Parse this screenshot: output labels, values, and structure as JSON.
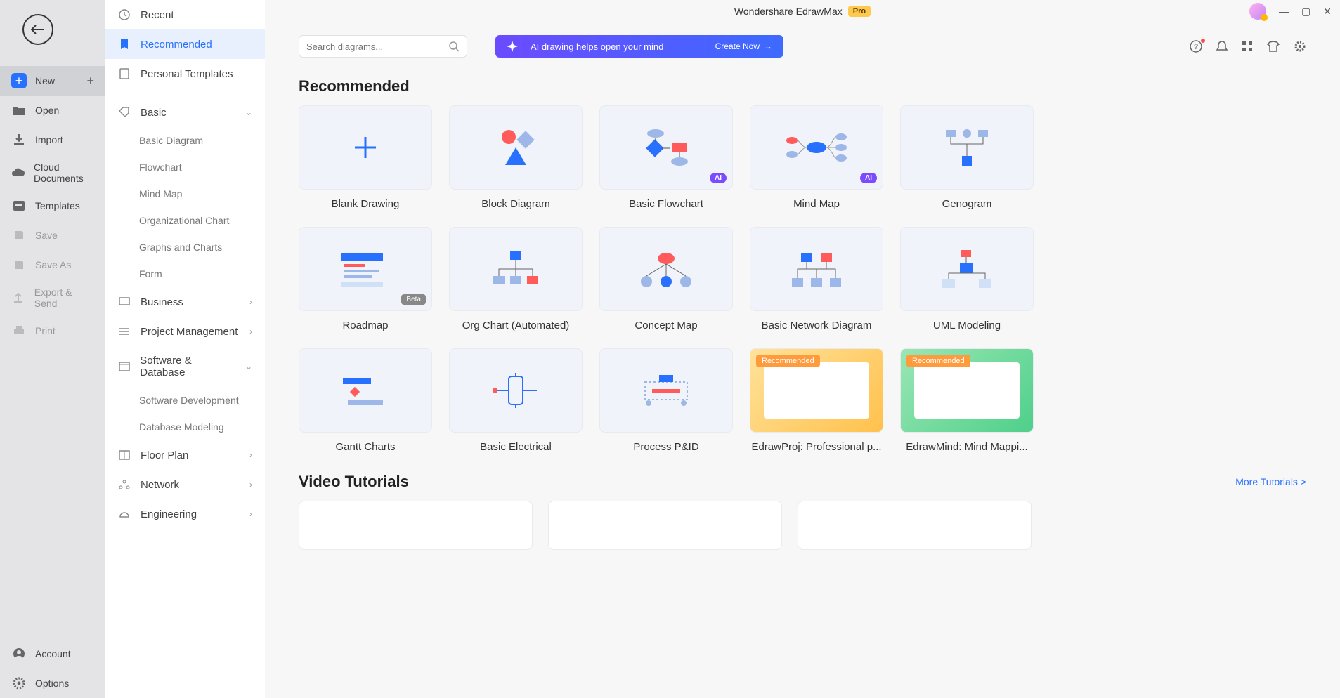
{
  "app": {
    "title": "Wondershare EdrawMax",
    "pro": "Pro"
  },
  "leftNav": {
    "new": "New",
    "open": "Open",
    "import": "Import",
    "cloud": "Cloud Documents",
    "templates": "Templates",
    "save": "Save",
    "saveAs": "Save As",
    "export": "Export & Send",
    "print": "Print",
    "account": "Account",
    "options": "Options"
  },
  "categories": {
    "recent": "Recent",
    "recommended": "Recommended",
    "personal": "Personal Templates",
    "basic": "Basic",
    "basicItems": {
      "diagram": "Basic Diagram",
      "flowchart": "Flowchart",
      "mindmap": "Mind Map",
      "org": "Organizational Chart",
      "graphs": "Graphs and Charts",
      "form": "Form"
    },
    "business": "Business",
    "project": "Project Management",
    "software": "Software & Database",
    "softwareItems": {
      "dev": "Software Development",
      "db": "Database Modeling"
    },
    "floorplan": "Floor Plan",
    "network": "Network",
    "engineering": "Engineering"
  },
  "search": {
    "placeholder": "Search diagrams..."
  },
  "aiBanner": {
    "text": "AI drawing helps open your mind",
    "cta": "Create Now"
  },
  "sections": {
    "recommended": "Recommended",
    "tutorials": "Video Tutorials",
    "more": "More Tutorials  >"
  },
  "templates": [
    {
      "label": "Blank Drawing",
      "badge": null
    },
    {
      "label": "Block Diagram",
      "badge": null
    },
    {
      "label": "Basic Flowchart",
      "badge": "AI"
    },
    {
      "label": "Mind Map",
      "badge": "AI"
    },
    {
      "label": "Genogram",
      "badge": null
    },
    {
      "label": "Roadmap",
      "badge": "Beta"
    },
    {
      "label": "Org Chart (Automated)",
      "badge": null
    },
    {
      "label": "Concept Map",
      "badge": null
    },
    {
      "label": "Basic Network Diagram",
      "badge": null
    },
    {
      "label": "UML Modeling",
      "badge": null
    },
    {
      "label": "Gantt Charts",
      "badge": null
    },
    {
      "label": "Basic Electrical",
      "badge": null
    },
    {
      "label": "Process P&ID",
      "badge": null
    },
    {
      "label": "EdrawProj: Professional p...",
      "badge": "Recommended"
    },
    {
      "label": "EdrawMind: Mind Mappi...",
      "badge": "Recommended"
    }
  ]
}
